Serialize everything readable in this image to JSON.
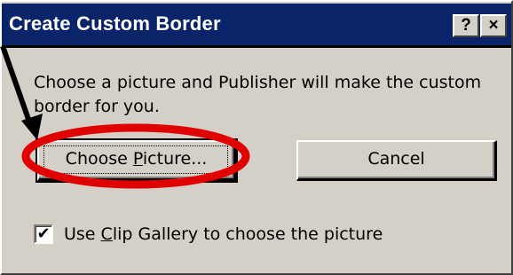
{
  "dialog": {
    "title": "Create Custom Border",
    "help_button": "?",
    "close_button": "×",
    "message": "Choose a picture and Publisher will make the custom border for you.",
    "choose_button": {
      "before": "Choose ",
      "accel": "P",
      "after": "icture..."
    },
    "cancel_button": "Cancel",
    "checkbox": {
      "checked": true,
      "mark": "✔",
      "label_before": "Use ",
      "label_accel": "C",
      "label_after": "lip Gallery to choose the picture"
    }
  },
  "colors": {
    "titlebar": "#0a246a",
    "face": "#d4d0c8",
    "annotation_circle": "#e00000",
    "annotation_arrow": "#000000"
  }
}
